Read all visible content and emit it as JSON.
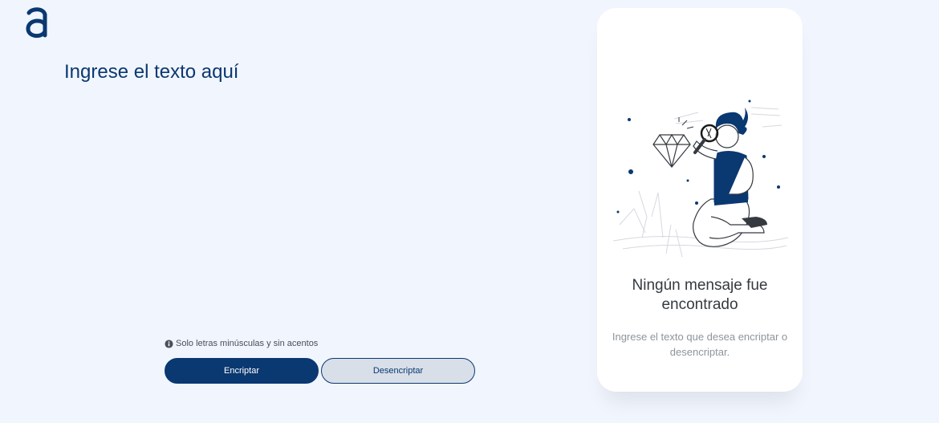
{
  "brand": {
    "logo_icon": "alura-a-logo-icon",
    "accent_color": "#0a3871"
  },
  "input": {
    "placeholder": "Ingrese el texto aquí",
    "value": ""
  },
  "hint": {
    "icon": "info-icon",
    "text": "Solo letras minúsculas y sin acentos"
  },
  "buttons": {
    "encrypt_label": "Encriptar",
    "decrypt_label": "Desencriptar"
  },
  "output": {
    "illustration": "person-with-magnifying-glass-illustration",
    "title": "Ningún mensaje fue encontrado",
    "subtitle": "Ingrese el texto que desea encriptar o desencriptar."
  }
}
